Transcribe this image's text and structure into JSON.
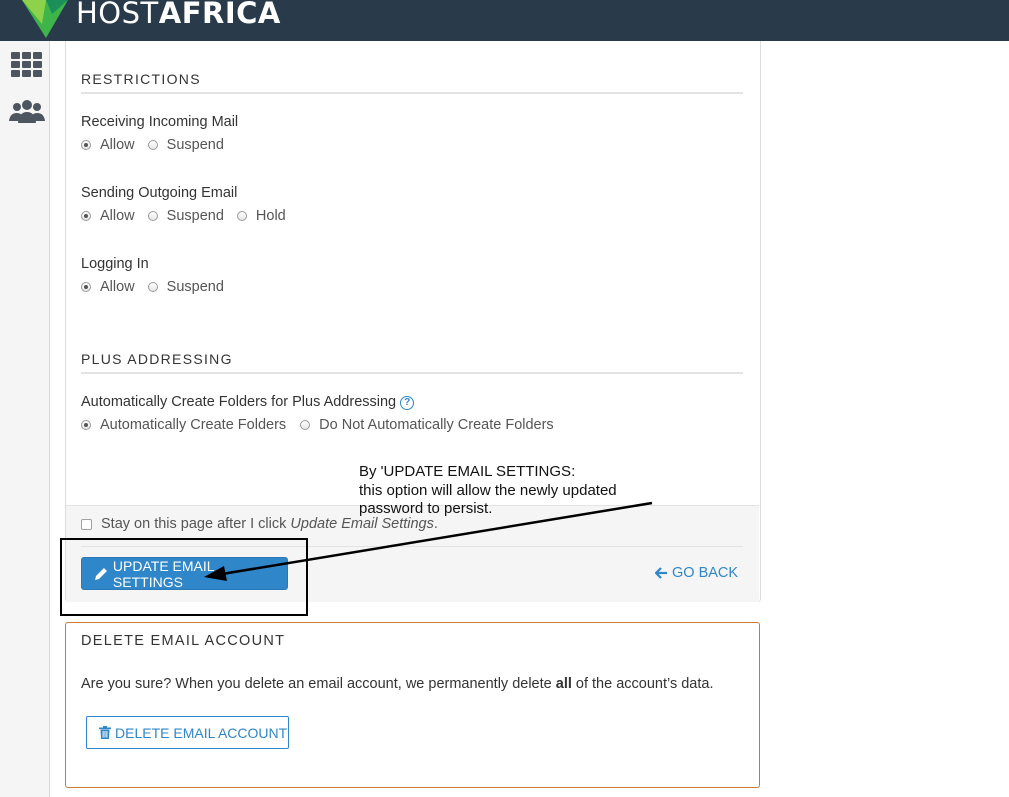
{
  "brand": {
    "name_light": "HOST",
    "name_bold": "AFRICA"
  },
  "sidebar": {
    "icons": [
      "grid-icon",
      "users-icon"
    ]
  },
  "restrictions": {
    "title": "RESTRICTIONS",
    "receiving": {
      "label": "Receiving Incoming Mail",
      "options": [
        "Allow",
        "Suspend"
      ],
      "selected": "Allow"
    },
    "sending": {
      "label": "Sending Outgoing Email",
      "options": [
        "Allow",
        "Suspend",
        "Hold"
      ],
      "selected": "Allow"
    },
    "login": {
      "label": "Logging In",
      "options": [
        "Allow",
        "Suspend"
      ],
      "selected": "Allow"
    }
  },
  "plus": {
    "title": "PLUS ADDRESSING",
    "label": "Automatically Create Folders for Plus Addressing",
    "help": "?",
    "options": [
      "Automatically Create Folders",
      "Do Not Automatically Create Folders"
    ],
    "selected": "Automatically Create Folders"
  },
  "footer": {
    "stay_prefix": "Stay on this page after I click ",
    "stay_emph": "Update Email Settings",
    "stay_suffix": ".",
    "update_button": "UPDATE EMAIL SETTINGS",
    "go_back": "GO BACK"
  },
  "annotation": {
    "lines": [
      "By 'UPDATE EMAIL SETTINGS:",
      "this option will allow the newly updated",
      "password to persist."
    ]
  },
  "delete": {
    "title": "DELETE EMAIL ACCOUNT",
    "text_prefix": "Are you sure? When you delete an email account, we permanently delete ",
    "text_bold": "all",
    "text_suffix": " of the account’s data.",
    "button": "DELETE EMAIL ACCOUNT"
  },
  "colors": {
    "accent": "#2f86c9",
    "topbar": "#293a4a",
    "danger_border": "#c97a3a",
    "logo_green": "#3db54a"
  }
}
